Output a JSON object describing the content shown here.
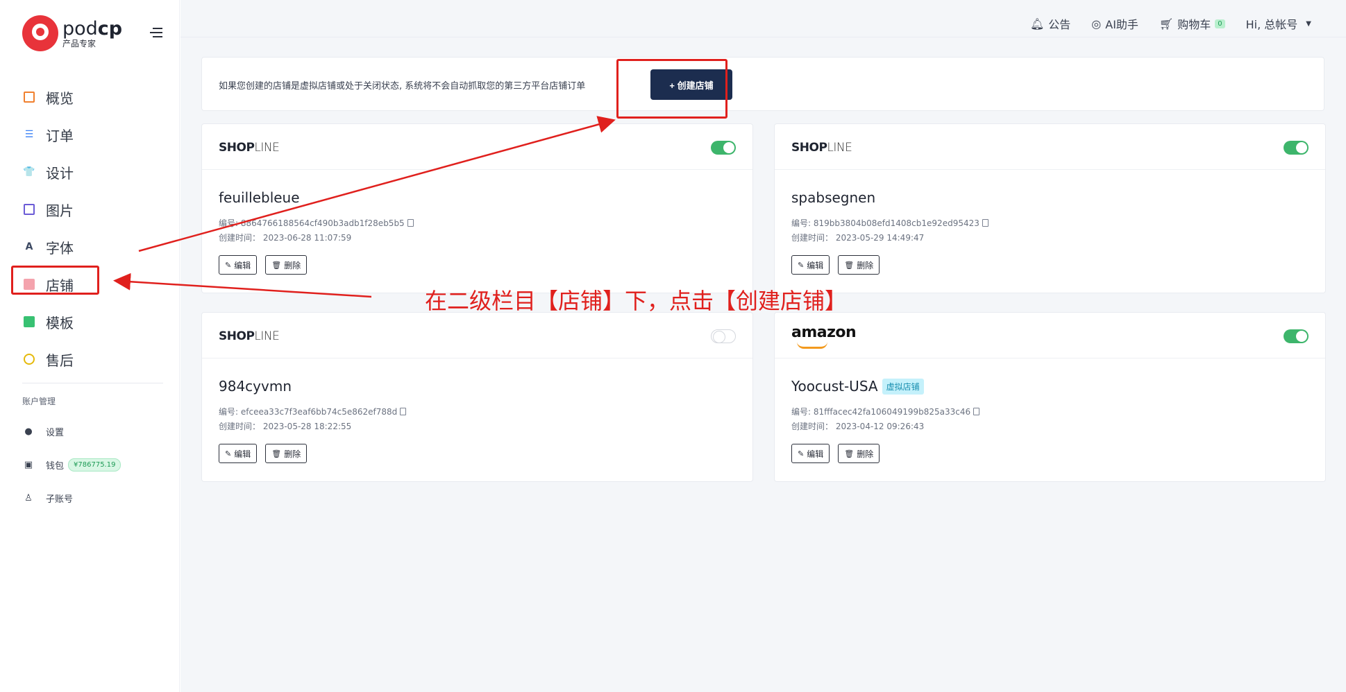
{
  "brand": {
    "name_light": "pod",
    "name_bold": "cp",
    "subtitle": "产品专家"
  },
  "sidebar": {
    "items": [
      {
        "label": "概览",
        "icon": "overview-icon"
      },
      {
        "label": "订单",
        "icon": "order-list-icon"
      },
      {
        "label": "设计",
        "icon": "tshirt-icon"
      },
      {
        "label": "图片",
        "icon": "image-icon"
      },
      {
        "label": "字体",
        "icon": "font-icon"
      },
      {
        "label": "店铺",
        "icon": "shop-icon"
      },
      {
        "label": "模板",
        "icon": "template-icon"
      },
      {
        "label": "售后",
        "icon": "chat-icon"
      }
    ],
    "account_section_title": "账户管理",
    "account_items": [
      {
        "label": "设置",
        "icon": "user-icon"
      },
      {
        "label": "钱包",
        "icon": "wallet-icon",
        "badge": "¥786775.19"
      },
      {
        "label": "子账号",
        "icon": "sub-account-icon"
      }
    ]
  },
  "header": {
    "notice": "公告",
    "ai": "AI助手",
    "cart": "购物车",
    "cart_count": "0",
    "user": "Hi, 总帐号"
  },
  "notice_bar": {
    "text": "如果您创建的店铺是虚拟店铺或处于关闭状态, 系统将不会自动抓取您的第三方平台店铺订单",
    "create_button": "+ 创建店铺"
  },
  "stores": [
    {
      "platform": "SHOPLINE",
      "name": "feuillebleue",
      "id_label": "编号: 8864766188564cf490b3adb1f28eb5b5",
      "created_label": "创建时间： 2023-06-28 11:07:59",
      "enabled": true,
      "virtual_badge": ""
    },
    {
      "platform": "SHOPLINE",
      "name": "spabsegnen",
      "id_label": "编号: 819bb3804b08efd1408cb1e92ed95423",
      "created_label": "创建时间： 2023-05-29 14:49:47",
      "enabled": true,
      "virtual_badge": ""
    },
    {
      "platform": "SHOPLINE",
      "name": "984cyvmn",
      "id_label": "编号: efceea33c7f3eaf6bb74c5e862ef788d",
      "created_label": "创建时间： 2023-05-28 18:22:55",
      "enabled": false,
      "virtual_badge": ""
    },
    {
      "platform": "amazon",
      "name": "Yoocust-USA",
      "id_label": "编号: 81fffacec42fa106049199b825a33c46",
      "created_label": "创建时间： 2023-04-12 09:26:43",
      "enabled": true,
      "virtual_badge": "虚拟店铺"
    }
  ],
  "card_buttons": {
    "edit": "编辑",
    "delete": "删除"
  },
  "annotation": {
    "text": "在二级栏目【店铺】下，点击【创建店铺】"
  },
  "colors": {
    "accent": "#1c2d4f",
    "toggle_on": "#3db56b",
    "annotation_red": "#e0201d",
    "brand_red": "#e8333a"
  }
}
